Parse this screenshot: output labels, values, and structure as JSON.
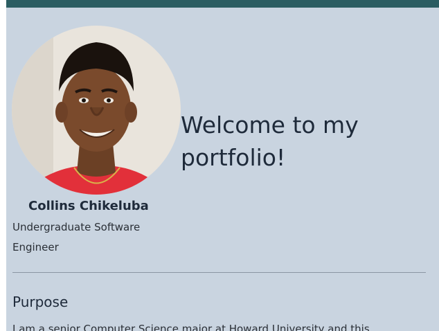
{
  "header": {
    "accent_color": "#2b5d62",
    "background_color": "#c9d4e0"
  },
  "profile": {
    "avatar_alt": "profile-photo",
    "name": "Collins Chikeluba",
    "role": "Undergraduate Software Engineer"
  },
  "hero": {
    "welcome": "Welcome to my portfolio!"
  },
  "purpose": {
    "heading": "Purpose",
    "text": "I am a senior Computer Science major at Howard University and this"
  }
}
